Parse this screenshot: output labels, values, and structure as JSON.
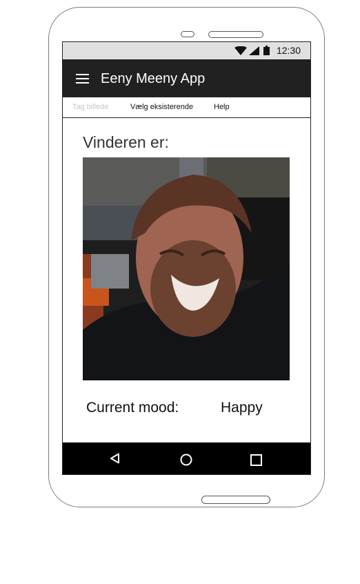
{
  "status_bar": {
    "time": "12:30",
    "icons": [
      "wifi-icon",
      "signal-icon",
      "battery-icon"
    ]
  },
  "app_bar": {
    "menu_icon": "hamburger-menu-icon",
    "title": "Eeny Meeny App"
  },
  "tabs": [
    {
      "label": "Tag billede",
      "state": "disabled"
    },
    {
      "label": "Vælg eksisterende",
      "state": "active"
    },
    {
      "label": "Help",
      "state": "normal"
    }
  ],
  "main": {
    "winner_label": "Vinderen er:",
    "photo_icon": "winner-photo",
    "mood_label": "Current mood:",
    "mood_value": "Happy"
  },
  "nav_bar": {
    "icons": [
      "back-triangle-icon",
      "home-circle-icon",
      "recent-square-icon"
    ]
  },
  "colors": {
    "app_bar": "#212121",
    "status_bar": "#e0e0e0",
    "nav_bar": "#000000",
    "disabled_tab_text": "#c6c6c6"
  }
}
